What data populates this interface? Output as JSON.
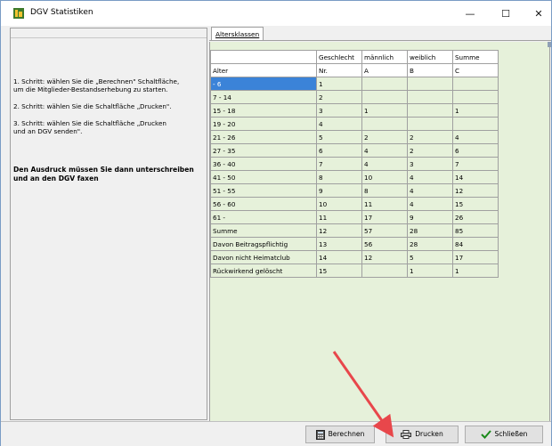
{
  "window": {
    "title": "DGV Statistiken",
    "min_glyph": "—",
    "max_glyph": "☐",
    "close_glyph": "✕"
  },
  "left_panel": {
    "step1": "1. Schritt: wählen Sie die „Berechnen\" Schaltfläche,\n    um die Mitglieder-Bestandserhebung zu starten.",
    "step2": "2. Schritt: wählen Sie die Schaltfläche „Drucken\".",
    "step3": "3. Schritt: wählen Sie die Schaltfläche „Drucken\n    und an DGV senden\".",
    "note": "Den Ausdruck müssen Sie dann unterschreiben\nund an den DGV faxen"
  },
  "tab": {
    "label": "Altersklassen"
  },
  "table": {
    "header1": [
      "",
      "Geschlecht",
      "männlich",
      "weiblich",
      "Summe"
    ],
    "header2": [
      "Alter",
      "Nr.",
      "A",
      "B",
      "C"
    ],
    "rows": [
      [
        " - 6",
        "1",
        "",
        "",
        ""
      ],
      [
        "7 - 14",
        "2",
        "",
        "",
        ""
      ],
      [
        "15 - 18",
        "3",
        "1",
        "",
        "1"
      ],
      [
        "19 - 20",
        "4",
        "",
        "",
        ""
      ],
      [
        "21 - 26",
        "5",
        "2",
        "2",
        "4"
      ],
      [
        "27 - 35",
        "6",
        "4",
        "2",
        "6"
      ],
      [
        "36 - 40",
        "7",
        "4",
        "3",
        "7"
      ],
      [
        "41 - 50",
        "8",
        "10",
        "4",
        "14"
      ],
      [
        "51 - 55",
        "9",
        "8",
        "4",
        "12"
      ],
      [
        "56 - 60",
        "10",
        "11",
        "4",
        "15"
      ],
      [
        "61 -",
        "11",
        "17",
        "9",
        "26"
      ],
      [
        "Summe",
        "12",
        "57",
        "28",
        "85"
      ],
      [
        "Davon Beitragspflichtig",
        "13",
        "56",
        "28",
        "84"
      ],
      [
        "Davon nicht Heimatclub",
        "14",
        "12",
        "5",
        "17"
      ],
      [
        "Rückwirkend gelöscht",
        "15",
        "",
        "1",
        "1"
      ]
    ]
  },
  "buttons": {
    "berechnen": "Berechnen",
    "drucken": "Drucken",
    "schliessen": "Schließen"
  },
  "colors": {
    "selection": "#3b83d8",
    "grid_bg": "#e6f1da",
    "arrow": "#e8474b"
  }
}
